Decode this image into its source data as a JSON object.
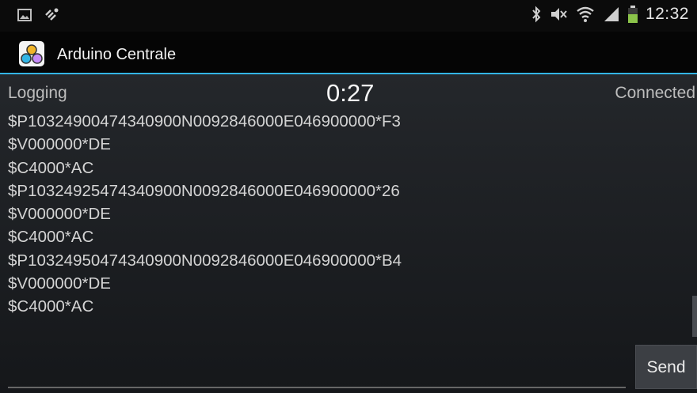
{
  "status_bar": {
    "time": "12:32",
    "icons": [
      "gallery-icon",
      "usb-debug-icon",
      "bluetooth-icon",
      "mute-icon",
      "wifi-icon",
      "signal-icon",
      "battery-icon"
    ]
  },
  "action_bar": {
    "title": "Arduino Centrale",
    "icon": "arduino-centrale-app-icon"
  },
  "main": {
    "state_label": "Logging",
    "timer": "0:27",
    "connection_status": "Connected",
    "log_lines": [
      "$P10324900474340900N0092846000E046900000*F3",
      "$V000000*DE",
      "$C4000*AC",
      "$P10324925474340900N0092846000E046900000*26",
      "$V000000*DE",
      "$C4000*AC",
      "$P10324950474340900N0092846000E046900000*B4",
      "$V000000*DE",
      "$C4000*AC"
    ],
    "input_value": "",
    "send_label": "Send"
  },
  "colors": {
    "accent_divider": "#33b5e5",
    "background": "#1c1f22",
    "battery": "#8bc34a"
  }
}
